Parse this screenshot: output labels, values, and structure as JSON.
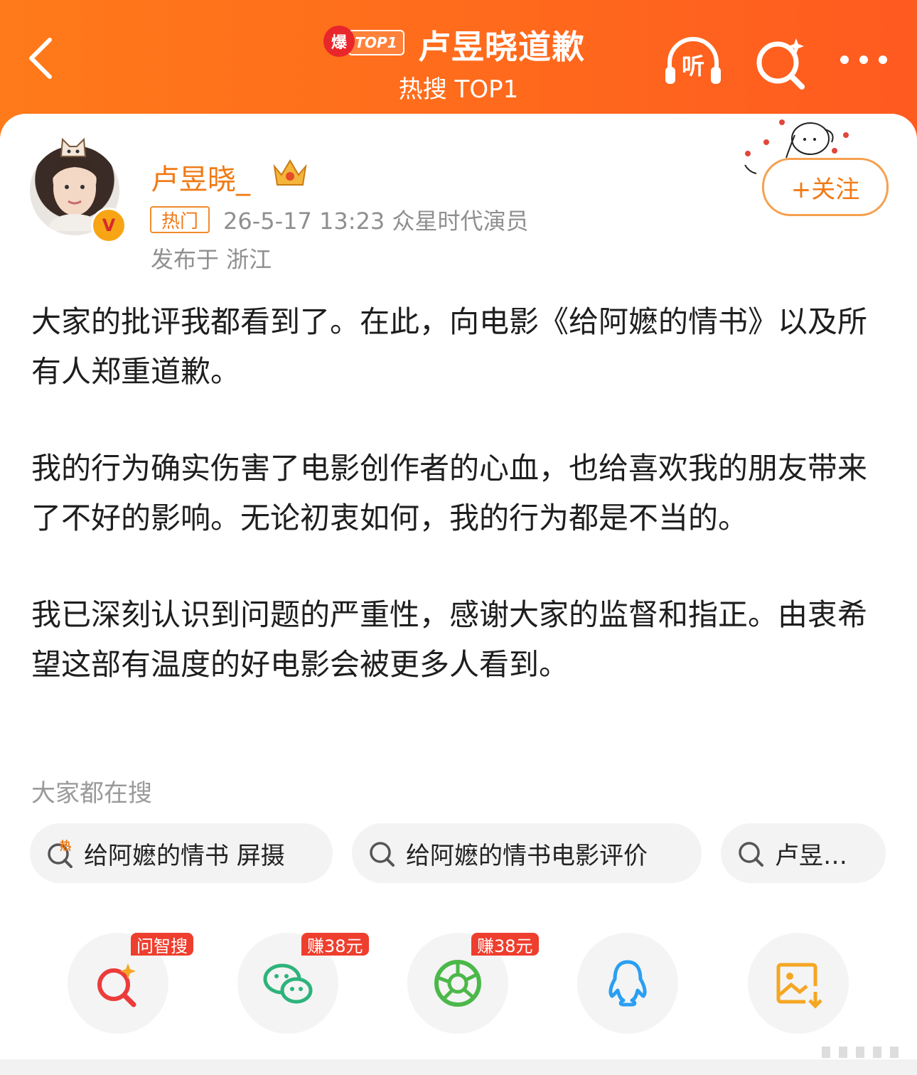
{
  "header": {
    "bao_label": "爆",
    "top_badge": "TOP1",
    "title": "卢昱晓道歉",
    "subtitle": "热搜 TOP1",
    "listen_label": "听",
    "accent_color": "#ff6e1c"
  },
  "post": {
    "author": "卢昱晓_",
    "hot_tag": "热门",
    "meta": "26-5-17 13:23  众星时代演员",
    "location": "发布于 浙江",
    "follow_label": "+关注",
    "paragraphs": [
      "大家的批评我都看到了。在此，向电影《给阿嬷的情书》以及所有人郑重道歉。",
      "我的行为确实伤害了电影创作者的心血，也给喜欢我的朋友带来了不好的影响。无论初衷如何，我的行为都是不当的。",
      "我已深刻认识到问题的严重性，感谢大家的监督和指正。由衷希望这部有温度的好电影会被更多人看到。"
    ]
  },
  "search": {
    "label": "大家都在搜",
    "chips": [
      {
        "text": "给阿嬷的情书 屏摄",
        "icon": "hot-search-icon"
      },
      {
        "text": "给阿嬷的情书电影评价",
        "icon": "search-icon"
      },
      {
        "text": "卢昱…",
        "icon": "search-icon"
      }
    ]
  },
  "share": [
    {
      "icon": "ai-search-icon",
      "tag": "问智搜"
    },
    {
      "icon": "wechat-icon",
      "tag": "赚38元"
    },
    {
      "icon": "moments-icon",
      "tag": "赚38元"
    },
    {
      "icon": "qq-icon",
      "tag": ""
    },
    {
      "icon": "save-image-icon",
      "tag": ""
    }
  ]
}
